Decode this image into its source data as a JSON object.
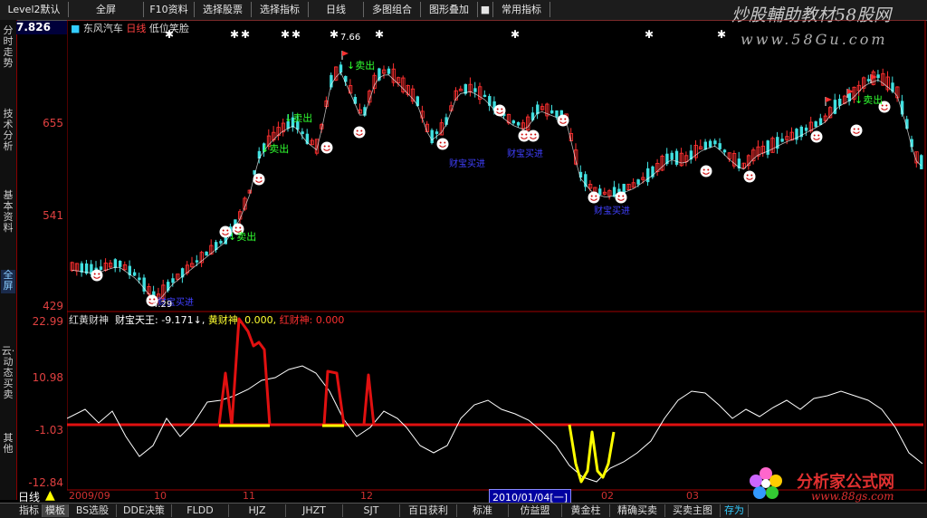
{
  "toolbar": {
    "items": [
      "Level2默认",
      "全屏",
      "F10资料",
      "选择股票",
      "选择指标",
      "日线",
      "多图组合",
      "图形叠加",
      "常用指标"
    ]
  },
  "watermark_top": {
    "title": "炒股輔助教材58股网",
    "url": "www.58Gu.com"
  },
  "watermark_bottom": {
    "title": "分析家公式网",
    "url": "www.88gs.com"
  },
  "left_tabs": [
    "分时走势",
    "技术分析",
    "基本资料",
    "全屏",
    "云·动态买卖",
    "其他"
  ],
  "price_panel": {
    "stock_name": "东风汽车",
    "period": "日线",
    "indicator": "低位笑脸",
    "current_price": "7.826",
    "y_ticks": [
      "655",
      "541",
      "429"
    ],
    "peak_label": "7.66",
    "low_label": "4.29",
    "sell_label": "卖出",
    "buy_label": "财宝买进"
  },
  "indicator_panel": {
    "name": "红黄财神",
    "line1_label": "财宝天王:",
    "line1_value": "-9.171↓,",
    "line2_label": "黄财神:",
    "line2_value": "0.000,",
    "line3_label": "红财神:",
    "line3_value": "0.000",
    "y_ticks": [
      "22.99",
      "10.98",
      "-1.03",
      "-12.84"
    ]
  },
  "time_axis": {
    "period_label": "日线",
    "labels": [
      "2009/09",
      "10",
      "11",
      "12",
      "01",
      "02",
      "03"
    ],
    "cursor_date": "2010/01/04[一]"
  },
  "bottom_tabs": [
    "指标",
    "模板",
    "BS选股",
    "DDE决策",
    "FLDD",
    "HJZ",
    "JHZT",
    "SJT",
    "百日获利",
    "标准",
    "仿益盟",
    "黄金柱",
    "精确买卖",
    "买卖主图",
    "存为"
  ],
  "colors": {
    "up": "#ff3030",
    "down": "#40e0e0",
    "ma": "#ffffff",
    "red_line": "#e01010",
    "yellow": "#ffff00",
    "buy_text": "#4040ff",
    "sell_text": "#30ff30"
  }
}
